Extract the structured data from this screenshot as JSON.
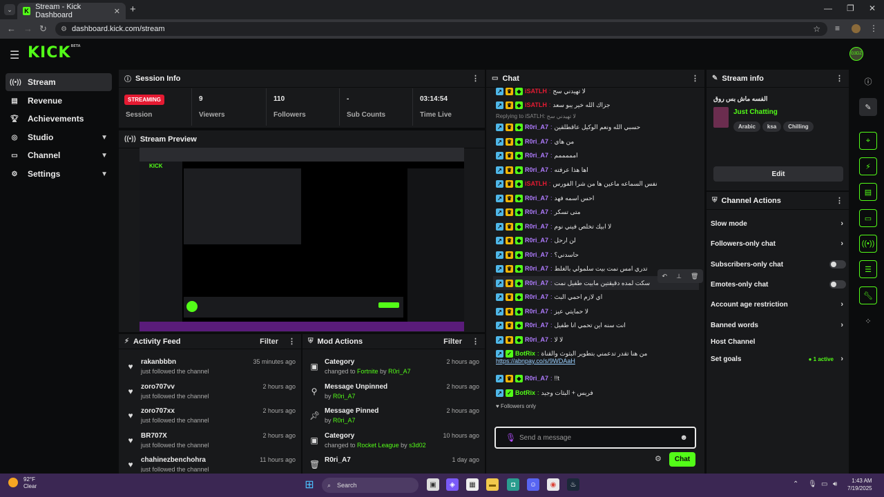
{
  "browser": {
    "tab_title": "Stream - Kick Dashboard",
    "url": "dashboard.kick.com/stream"
  },
  "header": {
    "logo": "KICK",
    "logo_sup": "BETA",
    "avatar": "G3DZ"
  },
  "sidebar": {
    "items": [
      {
        "label": "Stream",
        "icon": "broadcast-icon",
        "active": true
      },
      {
        "label": "Revenue",
        "icon": "bar-chart-icon"
      },
      {
        "label": "Achievements",
        "icon": "trophy-icon"
      },
      {
        "label": "Studio",
        "icon": "camera-icon",
        "chevron": true
      },
      {
        "label": "Channel",
        "icon": "screen-icon",
        "chevron": true
      },
      {
        "label": "Settings",
        "icon": "gear-icon",
        "chevron": true
      }
    ]
  },
  "session": {
    "title": "Session Info",
    "status": "STREAMING",
    "status_label": "Session",
    "stats": [
      {
        "value": "9",
        "label": "Viewers"
      },
      {
        "value": "110",
        "label": "Followers"
      },
      {
        "value": "-",
        "label": "Sub Counts"
      },
      {
        "value": "03:14:54",
        "label": "Time Live"
      }
    ]
  },
  "preview": {
    "title": "Stream Preview"
  },
  "activity": {
    "title": "Activity Feed",
    "filter": "Filter",
    "items": [
      {
        "name": "rakanbbbn",
        "sub": "just followed the channel",
        "time": "35 minutes ago"
      },
      {
        "name": "zoro707vv",
        "sub": "just followed the channel",
        "time": "2 hours ago"
      },
      {
        "name": "zoro707xx",
        "sub": "just followed the channel",
        "time": "2 hours ago"
      },
      {
        "name": "BR707X",
        "sub": "just followed the channel",
        "time": "2 hours ago"
      },
      {
        "name": "chahinezbenchohra",
        "sub": "just followed the channel",
        "time": "11 hours ago"
      }
    ]
  },
  "mod": {
    "title": "Mod Actions",
    "filter": "Filter",
    "items": [
      {
        "name": "Category",
        "pre": "changed to ",
        "a": "Fortnite",
        "mid": " by ",
        "b": "R0ri_A7",
        "time": "2 hours ago",
        "icon": "category-icon"
      },
      {
        "name": "Message Unpinned",
        "pre": "by ",
        "a": "",
        "mid": "",
        "b": "R0ri_A7",
        "time": "2 hours ago",
        "icon": "unpin-icon"
      },
      {
        "name": "Message Pinned",
        "pre": "by ",
        "a": "",
        "mid": "",
        "b": "R0ri_A7",
        "time": "2 hours ago",
        "icon": "pin-icon"
      },
      {
        "name": "Category",
        "pre": "changed to ",
        "a": "Rocket League",
        "mid": " by ",
        "b": "s3d02",
        "time": "10 hours ago",
        "icon": "category-icon"
      },
      {
        "name": "R0ri_A7",
        "pre": "",
        "a": "",
        "mid": "",
        "b": "",
        "time": "1 day ago",
        "icon": "trash-icon"
      }
    ]
  },
  "chat": {
    "title": "Chat",
    "followers_only": "Followers only",
    "placeholder": "Send a message",
    "send": "Chat",
    "lines": [
      {
        "user": "iSATLH",
        "color": "#e51a32",
        "msg": "لا تهيدني سح"
      },
      {
        "user": "iSATLH",
        "color": "#e51a32",
        "msg": "جزاك الله خير يبو سعد"
      },
      {
        "reply": "Replying to iSATLH: لا تهيدني سح"
      },
      {
        "user": "R0ri_A7",
        "color": "#b07cff",
        "msg": "حسبي الله ونعم الوكيل عاقطلقين"
      },
      {
        "user": "R0ri_A7",
        "color": "#b07cff",
        "msg": "من هاي"
      },
      {
        "user": "R0ri_A7",
        "color": "#b07cff",
        "msg": "امممممم"
      },
      {
        "user": "R0ri_A7",
        "color": "#b07cff",
        "msg": "اها هذا عرفته"
      },
      {
        "user": "iSATLH",
        "color": "#e51a32",
        "msg": "نفس السماعه ماعين ها من شرا الفورس"
      },
      {
        "user": "R0ri_A7",
        "color": "#b07cff",
        "msg": "احس اسمه فهد"
      },
      {
        "user": "R0ri_A7",
        "color": "#b07cff",
        "msg": "متى تسكر"
      },
      {
        "user": "R0ri_A7",
        "color": "#b07cff",
        "msg": "لا ابيك تخلص فيني نوم"
      },
      {
        "user": "R0ri_A7",
        "color": "#b07cff",
        "msg": "لن ارحل"
      },
      {
        "user": "R0ri_A7",
        "color": "#b07cff",
        "msg": "حاسدني؟"
      },
      {
        "user": "R0ri_A7",
        "color": "#b07cff",
        "msg": "تدري امس نمت بيت سلمولي بالغلط"
      },
      {
        "user": "R0ri_A7",
        "color": "#b07cff",
        "msg": "سكت لمده دقيقتين مابيت طفيل نمت"
      },
      {
        "user": "R0ri_A7",
        "color": "#b07cff",
        "msg": "اي لازم احمي البث"
      },
      {
        "user": "R0ri_A7",
        "color": "#b07cff",
        "msg": "لا حمايتي عيز"
      },
      {
        "user": "R0ri_A7",
        "color": "#b07cff",
        "msg": "انت سنه اين تحمي انا طفيل"
      },
      {
        "user": "R0ri_A7",
        "color": "#b07cff",
        "msg": "لا لا"
      },
      {
        "user": "BotRix",
        "color": "#53fc18",
        "msg": "من هنا تقدر تدعمني بتطوير البثوث والقناة"
      },
      {
        "link": "https://abnpay.co/s/9WDAaH"
      },
      {
        "user": "R0ri_A7",
        "color": "#b07cff",
        "msg": "!!t"
      },
      {
        "user": "BotRix",
        "color": "#53fc18",
        "msg": "فريس + البثات وجيد"
      }
    ]
  },
  "stream_info": {
    "title": "Stream info",
    "stream_title": "الفسه ماش بس روق",
    "category": "Just Chatting",
    "tags": [
      "Arabic",
      "ksa",
      "Chilling"
    ],
    "edit": "Edit"
  },
  "channel_actions": {
    "title": "Channel Actions",
    "items": [
      {
        "label": "Slow mode",
        "type": "arrow"
      },
      {
        "label": "Followers-only chat",
        "type": "arrow"
      },
      {
        "label": "Subscribers-only chat",
        "type": "toggle"
      },
      {
        "label": "Emotes-only chat",
        "type": "toggle"
      },
      {
        "label": "Account age restriction",
        "type": "arrow"
      },
      {
        "label": "Banned words",
        "type": "arrow"
      },
      {
        "label": "Host Channel",
        "type": "none"
      },
      {
        "label": "Set goals",
        "type": "arrow",
        "extra": "1 active"
      }
    ]
  },
  "taskbar": {
    "temp": "92°F",
    "cond": "Clear",
    "search": "Search",
    "time": "1:43 AM",
    "date": "7/19/2025"
  }
}
